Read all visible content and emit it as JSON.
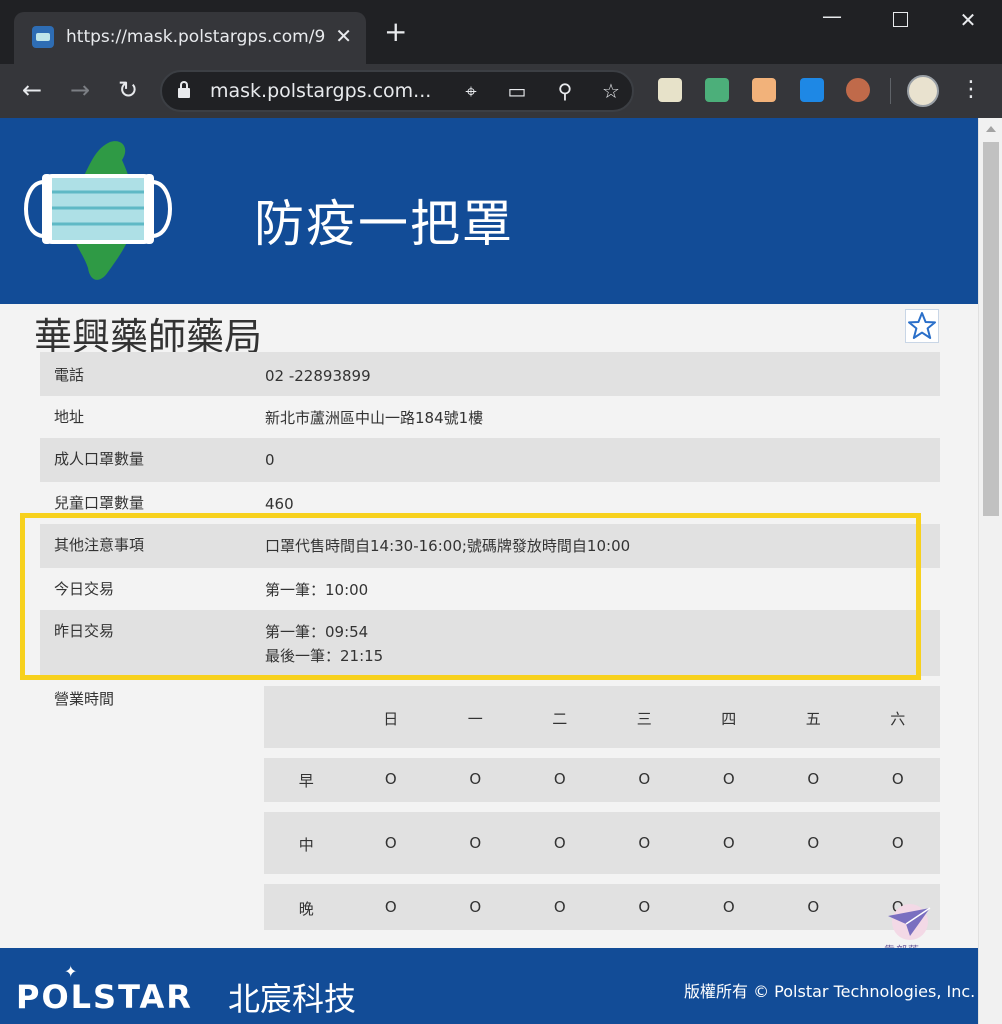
{
  "browser": {
    "tab_title": "https://mask.polstargps.com/9",
    "close_glyph": "✕",
    "new_tab_glyph": "+",
    "url": "mask.polstargps.com..."
  },
  "site": {
    "title": "防疫一把罩",
    "brand_color": "#124c97",
    "highlight_color": "#f7d11d"
  },
  "store": {
    "name": "華興藥師藥局",
    "favorite_glyph": "☆",
    "info": [
      {
        "label": "電話",
        "values": [
          "02 -22893899"
        ]
      },
      {
        "label": "地址",
        "values": [
          "新北市蘆洲區中山一路184號1樓"
        ]
      },
      {
        "label": "成人口罩數量",
        "values": [
          "0"
        ]
      },
      {
        "label": "兒童口罩數量",
        "values": [
          "460"
        ]
      },
      {
        "label": "其他注意事項",
        "values": [
          "口罩代售時間自14:30-16:00;號碼牌發放時間自10:00"
        ]
      },
      {
        "label": "今日交易",
        "values": [
          "第一筆：10:00"
        ]
      },
      {
        "label": "昨日交易",
        "values": [
          "第一筆：09:54",
          "最後一筆：21:15"
        ]
      }
    ],
    "hours": {
      "label": "營業時間",
      "days": [
        "",
        "日",
        "一",
        "二",
        "三",
        "四",
        "五",
        "六"
      ],
      "rows": [
        {
          "period": "早",
          "marks": [
            "O",
            "O",
            "O",
            "O",
            "O",
            "O",
            "O"
          ]
        },
        {
          "period": "中",
          "marks": [
            "O",
            "O",
            "O",
            "O",
            "O",
            "O",
            "O"
          ]
        },
        {
          "period": "晚",
          "marks": [
            "O",
            "O",
            "O",
            "O",
            "O",
            "O",
            "O"
          ]
        }
      ]
    }
  },
  "watermark": {
    "text": "靠部落"
  },
  "footer": {
    "brand": "POLSTAR",
    "brand_cn": "北宸科技",
    "copyright": "版權所有 © Polstar Technologies, Inc."
  }
}
